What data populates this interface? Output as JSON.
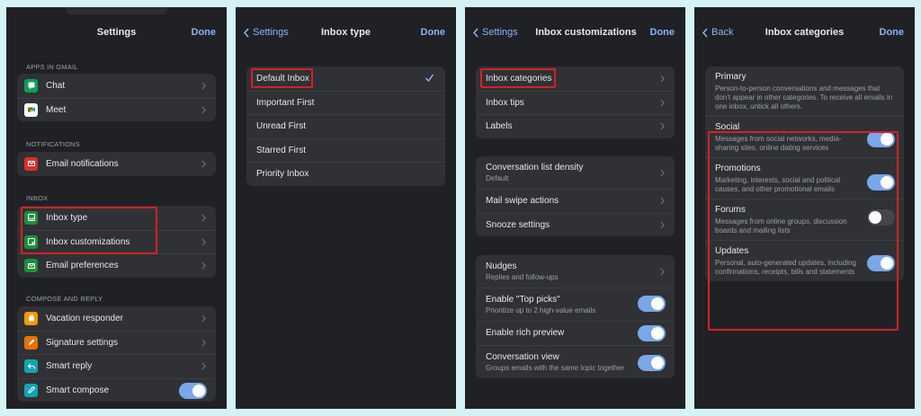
{
  "panel1": {
    "title": "Settings",
    "done": "Done",
    "sections": {
      "apps": "APPS IN GMAIL",
      "notifications": "NOTIFICATIONS",
      "inbox": "INBOX",
      "compose": "COMPOSE AND REPLY"
    },
    "items": {
      "chat": "Chat",
      "meet": "Meet",
      "email_notifications": "Email notifications",
      "inbox_type": "Inbox type",
      "inbox_customizations": "Inbox customizations",
      "email_preferences": "Email preferences",
      "vacation_responder": "Vacation responder",
      "signature_settings": "Signature settings",
      "smart_reply": "Smart reply",
      "smart_compose": "Smart compose"
    },
    "smart_compose_on": true
  },
  "panel2": {
    "back": "Settings",
    "title": "Inbox type",
    "done": "Done",
    "options": [
      "Default Inbox",
      "Important First",
      "Unread First",
      "Starred First",
      "Priority Inbox"
    ],
    "selected": "Default Inbox"
  },
  "panel3": {
    "back": "Settings",
    "title": "Inbox customizations",
    "done": "Done",
    "items": {
      "inbox_categories": "Inbox categories",
      "inbox_tips": "Inbox tips",
      "labels": "Labels",
      "density": "Conversation list density",
      "density_value": "Default",
      "swipe": "Mail swipe actions",
      "snooze": "Snooze settings",
      "nudges": "Nudges",
      "nudges_sub": "Replies and follow-ups",
      "top_picks": "Enable \"Top picks\"",
      "top_picks_sub": "Prioritize up to 2 high-value emails",
      "rich_preview": "Enable rich preview",
      "conv_view": "Conversation view",
      "conv_view_sub": "Groups emails with the same topic together"
    },
    "toggles": {
      "top_picks": true,
      "rich_preview": true,
      "conv_view": true
    }
  },
  "panel4": {
    "back": "Back",
    "title": "Inbox categories",
    "done": "Done",
    "categories": {
      "primary": {
        "label": "Primary",
        "desc": "Person-to-person conversations and messages that don't appear in other categories. To receive all emails in one inbox, untick all others."
      },
      "social": {
        "label": "Social",
        "desc": "Messages from social networks, media-sharing sites, online dating services",
        "on": true
      },
      "promotions": {
        "label": "Promotions",
        "desc": "Marketing, interests, social and political causes, and other promotional emails",
        "on": true
      },
      "forums": {
        "label": "Forums",
        "desc": "Messages from online groups, discussion boards and mailing lists",
        "on": false
      },
      "updates": {
        "label": "Updates",
        "desc": "Personal, auto-generated updates, including confirmations, receipts, bills and statements",
        "on": true
      }
    }
  },
  "colors": {
    "panel_bg": "#202125",
    "group_bg": "#303134",
    "accent": "#8ab4f8",
    "toggle_on": "#7aa7e8",
    "highlight": "#d3202a",
    "page_bg": "#d5f2f6"
  }
}
